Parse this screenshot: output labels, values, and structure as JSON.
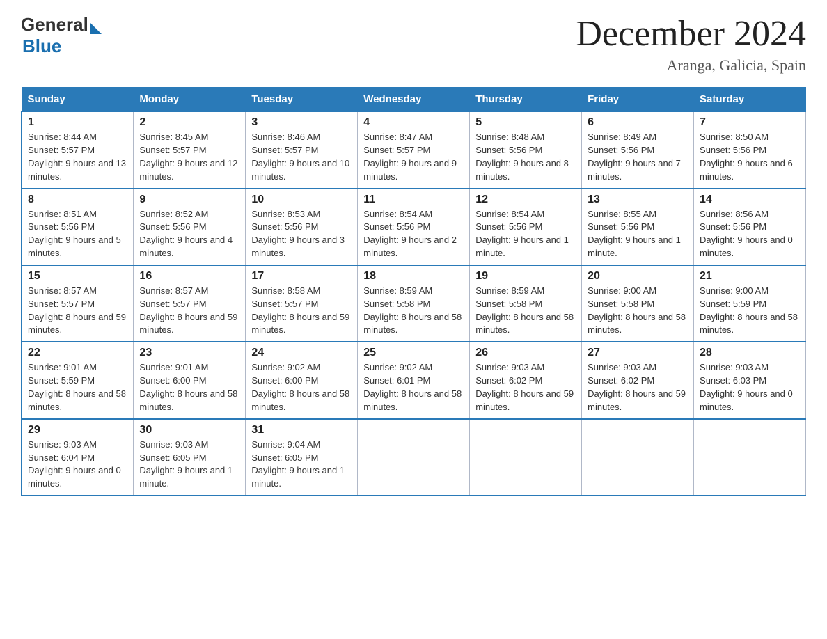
{
  "logo": {
    "text_general": "General",
    "text_blue": "Blue"
  },
  "header": {
    "title": "December 2024",
    "subtitle": "Aranga, Galicia, Spain"
  },
  "weekdays": [
    "Sunday",
    "Monday",
    "Tuesday",
    "Wednesday",
    "Thursday",
    "Friday",
    "Saturday"
  ],
  "weeks": [
    [
      {
        "day": "1",
        "sunrise": "8:44 AM",
        "sunset": "5:57 PM",
        "daylight": "9 hours and 13 minutes."
      },
      {
        "day": "2",
        "sunrise": "8:45 AM",
        "sunset": "5:57 PM",
        "daylight": "9 hours and 12 minutes."
      },
      {
        "day": "3",
        "sunrise": "8:46 AM",
        "sunset": "5:57 PM",
        "daylight": "9 hours and 10 minutes."
      },
      {
        "day": "4",
        "sunrise": "8:47 AM",
        "sunset": "5:57 PM",
        "daylight": "9 hours and 9 minutes."
      },
      {
        "day": "5",
        "sunrise": "8:48 AM",
        "sunset": "5:56 PM",
        "daylight": "9 hours and 8 minutes."
      },
      {
        "day": "6",
        "sunrise": "8:49 AM",
        "sunset": "5:56 PM",
        "daylight": "9 hours and 7 minutes."
      },
      {
        "day": "7",
        "sunrise": "8:50 AM",
        "sunset": "5:56 PM",
        "daylight": "9 hours and 6 minutes."
      }
    ],
    [
      {
        "day": "8",
        "sunrise": "8:51 AM",
        "sunset": "5:56 PM",
        "daylight": "9 hours and 5 minutes."
      },
      {
        "day": "9",
        "sunrise": "8:52 AM",
        "sunset": "5:56 PM",
        "daylight": "9 hours and 4 minutes."
      },
      {
        "day": "10",
        "sunrise": "8:53 AM",
        "sunset": "5:56 PM",
        "daylight": "9 hours and 3 minutes."
      },
      {
        "day": "11",
        "sunrise": "8:54 AM",
        "sunset": "5:56 PM",
        "daylight": "9 hours and 2 minutes."
      },
      {
        "day": "12",
        "sunrise": "8:54 AM",
        "sunset": "5:56 PM",
        "daylight": "9 hours and 1 minute."
      },
      {
        "day": "13",
        "sunrise": "8:55 AM",
        "sunset": "5:56 PM",
        "daylight": "9 hours and 1 minute."
      },
      {
        "day": "14",
        "sunrise": "8:56 AM",
        "sunset": "5:56 PM",
        "daylight": "9 hours and 0 minutes."
      }
    ],
    [
      {
        "day": "15",
        "sunrise": "8:57 AM",
        "sunset": "5:57 PM",
        "daylight": "8 hours and 59 minutes."
      },
      {
        "day": "16",
        "sunrise": "8:57 AM",
        "sunset": "5:57 PM",
        "daylight": "8 hours and 59 minutes."
      },
      {
        "day": "17",
        "sunrise": "8:58 AM",
        "sunset": "5:57 PM",
        "daylight": "8 hours and 59 minutes."
      },
      {
        "day": "18",
        "sunrise": "8:59 AM",
        "sunset": "5:58 PM",
        "daylight": "8 hours and 58 minutes."
      },
      {
        "day": "19",
        "sunrise": "8:59 AM",
        "sunset": "5:58 PM",
        "daylight": "8 hours and 58 minutes."
      },
      {
        "day": "20",
        "sunrise": "9:00 AM",
        "sunset": "5:58 PM",
        "daylight": "8 hours and 58 minutes."
      },
      {
        "day": "21",
        "sunrise": "9:00 AM",
        "sunset": "5:59 PM",
        "daylight": "8 hours and 58 minutes."
      }
    ],
    [
      {
        "day": "22",
        "sunrise": "9:01 AM",
        "sunset": "5:59 PM",
        "daylight": "8 hours and 58 minutes."
      },
      {
        "day": "23",
        "sunrise": "9:01 AM",
        "sunset": "6:00 PM",
        "daylight": "8 hours and 58 minutes."
      },
      {
        "day": "24",
        "sunrise": "9:02 AM",
        "sunset": "6:00 PM",
        "daylight": "8 hours and 58 minutes."
      },
      {
        "day": "25",
        "sunrise": "9:02 AM",
        "sunset": "6:01 PM",
        "daylight": "8 hours and 58 minutes."
      },
      {
        "day": "26",
        "sunrise": "9:03 AM",
        "sunset": "6:02 PM",
        "daylight": "8 hours and 59 minutes."
      },
      {
        "day": "27",
        "sunrise": "9:03 AM",
        "sunset": "6:02 PM",
        "daylight": "8 hours and 59 minutes."
      },
      {
        "day": "28",
        "sunrise": "9:03 AM",
        "sunset": "6:03 PM",
        "daylight": "9 hours and 0 minutes."
      }
    ],
    [
      {
        "day": "29",
        "sunrise": "9:03 AM",
        "sunset": "6:04 PM",
        "daylight": "9 hours and 0 minutes."
      },
      {
        "day": "30",
        "sunrise": "9:03 AM",
        "sunset": "6:05 PM",
        "daylight": "9 hours and 1 minute."
      },
      {
        "day": "31",
        "sunrise": "9:04 AM",
        "sunset": "6:05 PM",
        "daylight": "9 hours and 1 minute."
      },
      null,
      null,
      null,
      null
    ]
  ]
}
